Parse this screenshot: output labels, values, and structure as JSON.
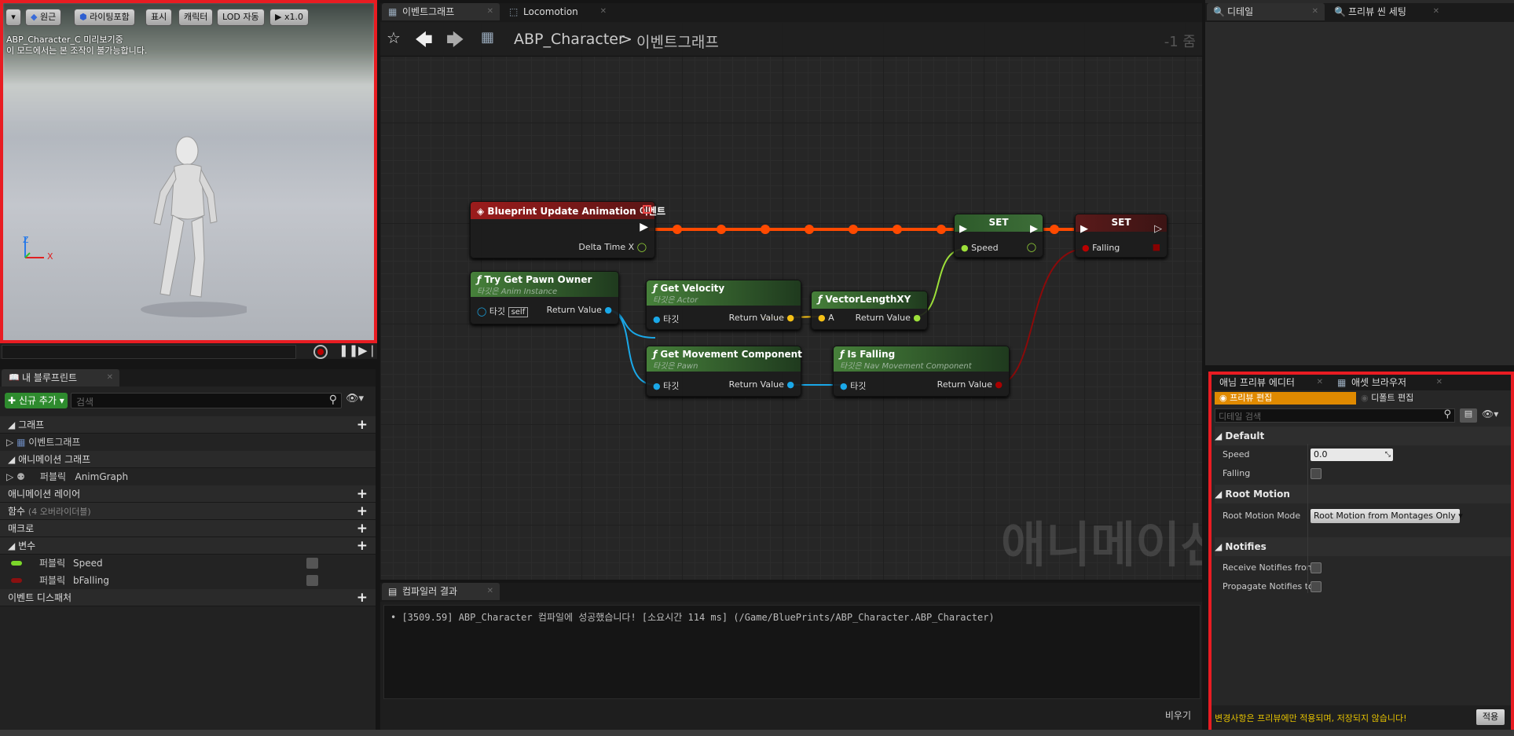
{
  "viewport": {
    "toolbar": {
      "dropdown": "▾",
      "perspective": "원근",
      "lighting": "라이팅포함",
      "show": "표시",
      "character": "캐릭터",
      "lod": "LOD 자동",
      "speed": "x1.0"
    },
    "info_line1": "ABP_Character_C 미리보기중",
    "info_line2": "이 모드에서는 본 조작이 불가능합니다.",
    "axis_z": "Z",
    "axis_x": "X"
  },
  "editor_tabs": [
    {
      "label": "이벤트그래프"
    },
    {
      "label": "Locomotion"
    }
  ],
  "graph_header": {
    "blueprint": "ABP_Character",
    "separator": ">",
    "graph": "이벤트그래프",
    "zoom": "-1 줌"
  },
  "watermark": "애니메이션",
  "nodes": {
    "event": {
      "title": "Blueprint Update Animation 이벤트",
      "pin_delta": "Delta Time X"
    },
    "try_get_pawn": {
      "title": "Try Get Pawn Owner",
      "subtitle": "타깃은 Anim Instance",
      "pin_target": "타깃",
      "pin_self": "self",
      "pin_return": "Return Value"
    },
    "get_velocity": {
      "title": "Get Velocity",
      "subtitle": "타깃은 Actor",
      "pin_target": "타깃",
      "pin_return": "Return Value"
    },
    "vector_length": {
      "title": "VectorLengthXY",
      "pin_a": "A",
      "pin_return": "Return Value"
    },
    "get_movement": {
      "title": "Get Movement Component",
      "subtitle": "타깃은 Pawn",
      "pin_target": "타깃",
      "pin_return": "Return Value"
    },
    "is_falling": {
      "title": "Is Falling",
      "subtitle": "타깃은 Nav Movement Component",
      "pin_target": "타깃",
      "pin_return": "Return Value"
    },
    "set_speed": {
      "title": "SET",
      "pin": "Speed"
    },
    "set_falling": {
      "title": "SET",
      "pin": "Falling"
    }
  },
  "my_blueprint": {
    "tab": "내 블루프린트",
    "add_new": "신규 추가",
    "search_placeholder": "검색",
    "sections": {
      "graphs": "그래프",
      "event_graph": "이벤트그래프",
      "anim_graphs": "애니메이션 그래프",
      "public": "퍼블릭",
      "anim_graph": "AnimGraph",
      "anim_layers": "애니메이션 레이어",
      "functions": "함수",
      "functions_count": "(4 오버라이더블)",
      "macros": "매크로",
      "variables": "변수",
      "dispatchers": "이벤트 디스패처"
    },
    "variables": [
      {
        "access": "퍼블릭",
        "name": "Speed",
        "color": "#7bd62a"
      },
      {
        "access": "퍼블릭",
        "name": "bFalling",
        "color": "#8a1010"
      }
    ]
  },
  "compiler": {
    "tab": "컴파일러 결과",
    "message": "[3509.59] ABP_Character 컴파일에 성공했습니다! [소요시간 114 ms] (/Game/BluePrints/ABP_Character.ABP_Character)",
    "clear": "비우기"
  },
  "right_tabs_top": [
    {
      "label": "디테일"
    },
    {
      "label": "프리뷰 씬 세팅"
    }
  ],
  "preview_panel": {
    "tabs": [
      {
        "label": "애님 프리뷰 에디터"
      },
      {
        "label": "애셋 브라우저"
      }
    ],
    "mode_preview": "프리뷰 편집",
    "mode_default": "디폴트 편집",
    "search_placeholder": "디테일 검색",
    "default_cat": "Default",
    "speed_label": "Speed",
    "speed_value": "0.0",
    "falling_label": "Falling",
    "root_motion_cat": "Root Motion",
    "root_motion_mode_label": "Root Motion Mode",
    "root_motion_mode_value": "Root Motion from Montages Only",
    "notifies_cat": "Notifies",
    "receive_notifies": "Receive Notifies from",
    "propagate_notifies": "Propagate Notifies to",
    "footer_msg": "변경사항은 프리뷰에만 적용되며, 저장되지 않습니다!",
    "apply": "적용"
  },
  "colors": {
    "exec_wire": "#ff4a00",
    "float_pin": "#9de03a",
    "object_pin": "#1aa8e8",
    "vector_pin": "#f5c016",
    "bool_pin": "#8a0a0a",
    "highlight": "#e81c22"
  }
}
